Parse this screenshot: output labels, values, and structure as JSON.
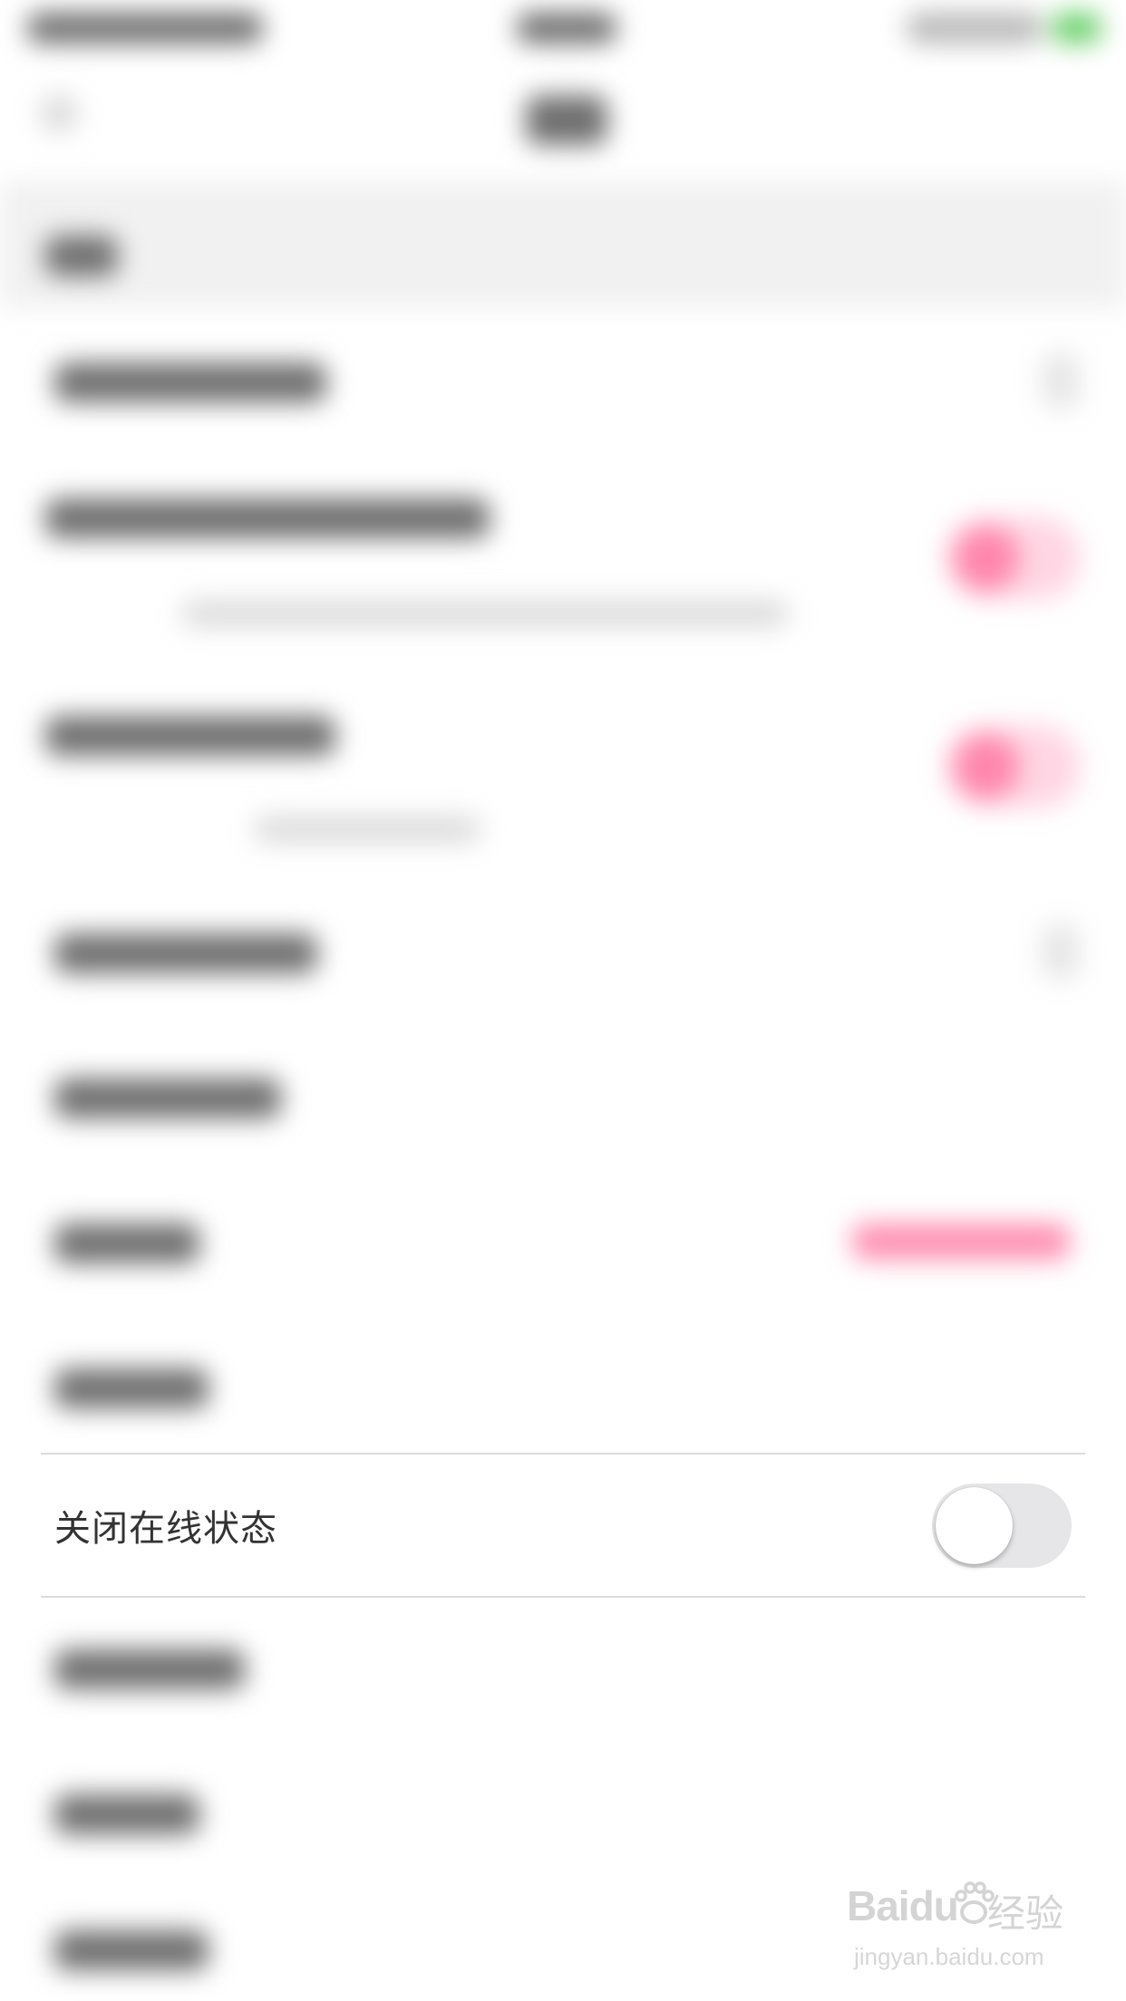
{
  "settings": {
    "online_status_row": {
      "label": "关闭在线状态",
      "toggle_on": false
    }
  },
  "colors": {
    "accent": "#ff86ad",
    "toggle_off_track": "#e6e6e8",
    "divider": "#dcdcdc"
  },
  "watermark": {
    "brand": "Baidu",
    "brand_suffix": "经验",
    "url": "jingyan.baidu.com",
    "icon": "paw-icon"
  }
}
